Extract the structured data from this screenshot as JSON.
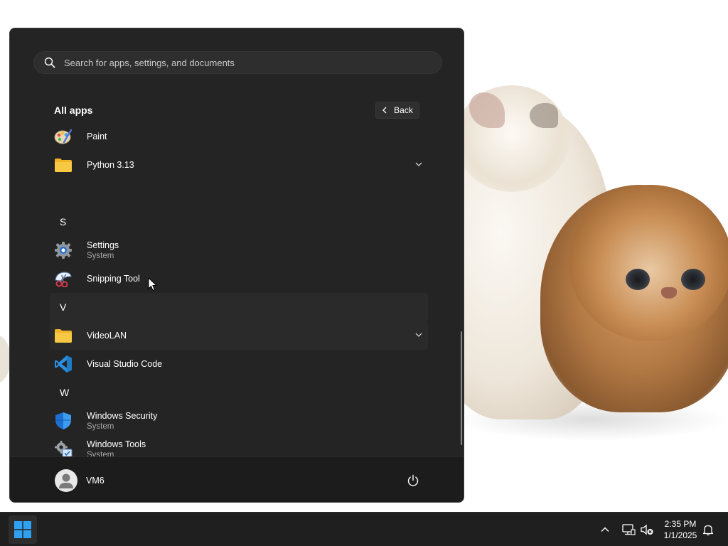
{
  "search": {
    "placeholder": "Search for apps, settings, and documents"
  },
  "all_apps": {
    "title": "All apps",
    "back_label": "Back",
    "rows": [
      {
        "kind": "app",
        "icon": "paint-icon",
        "label": "Paint"
      },
      {
        "kind": "folder",
        "icon": "folder-icon",
        "label": "Python 3.13",
        "expandable": true
      },
      {
        "kind": "letter",
        "label": "S"
      },
      {
        "kind": "app",
        "icon": "settings-gear-icon",
        "label": "Settings",
        "subtitle": "System"
      },
      {
        "kind": "app",
        "icon": "snipping-tool-icon",
        "label": "Snipping Tool"
      },
      {
        "kind": "letter",
        "label": "V"
      },
      {
        "kind": "folder",
        "icon": "folder-icon",
        "label": "VideoLAN",
        "expandable": true
      },
      {
        "kind": "app",
        "icon": "vscode-icon",
        "label": "Visual Studio Code"
      },
      {
        "kind": "letter",
        "label": "W"
      },
      {
        "kind": "app",
        "icon": "windows-security-shield-icon",
        "label": "Windows Security",
        "subtitle": "System"
      },
      {
        "kind": "app",
        "icon": "windows-tools-icon",
        "label": "Windows Tools",
        "subtitle": "System"
      }
    ]
  },
  "user": {
    "name": "VM6"
  },
  "taskbar": {
    "time": "2:35 PM",
    "date": "1/1/2025"
  },
  "colors": {
    "menu_bg": "#242424",
    "taskbar_bg": "#1f1f1f",
    "folder_yellow": "#f7c843",
    "vscode_blue": "#2a8fe0",
    "windows_blue": "#2ea1f3"
  }
}
